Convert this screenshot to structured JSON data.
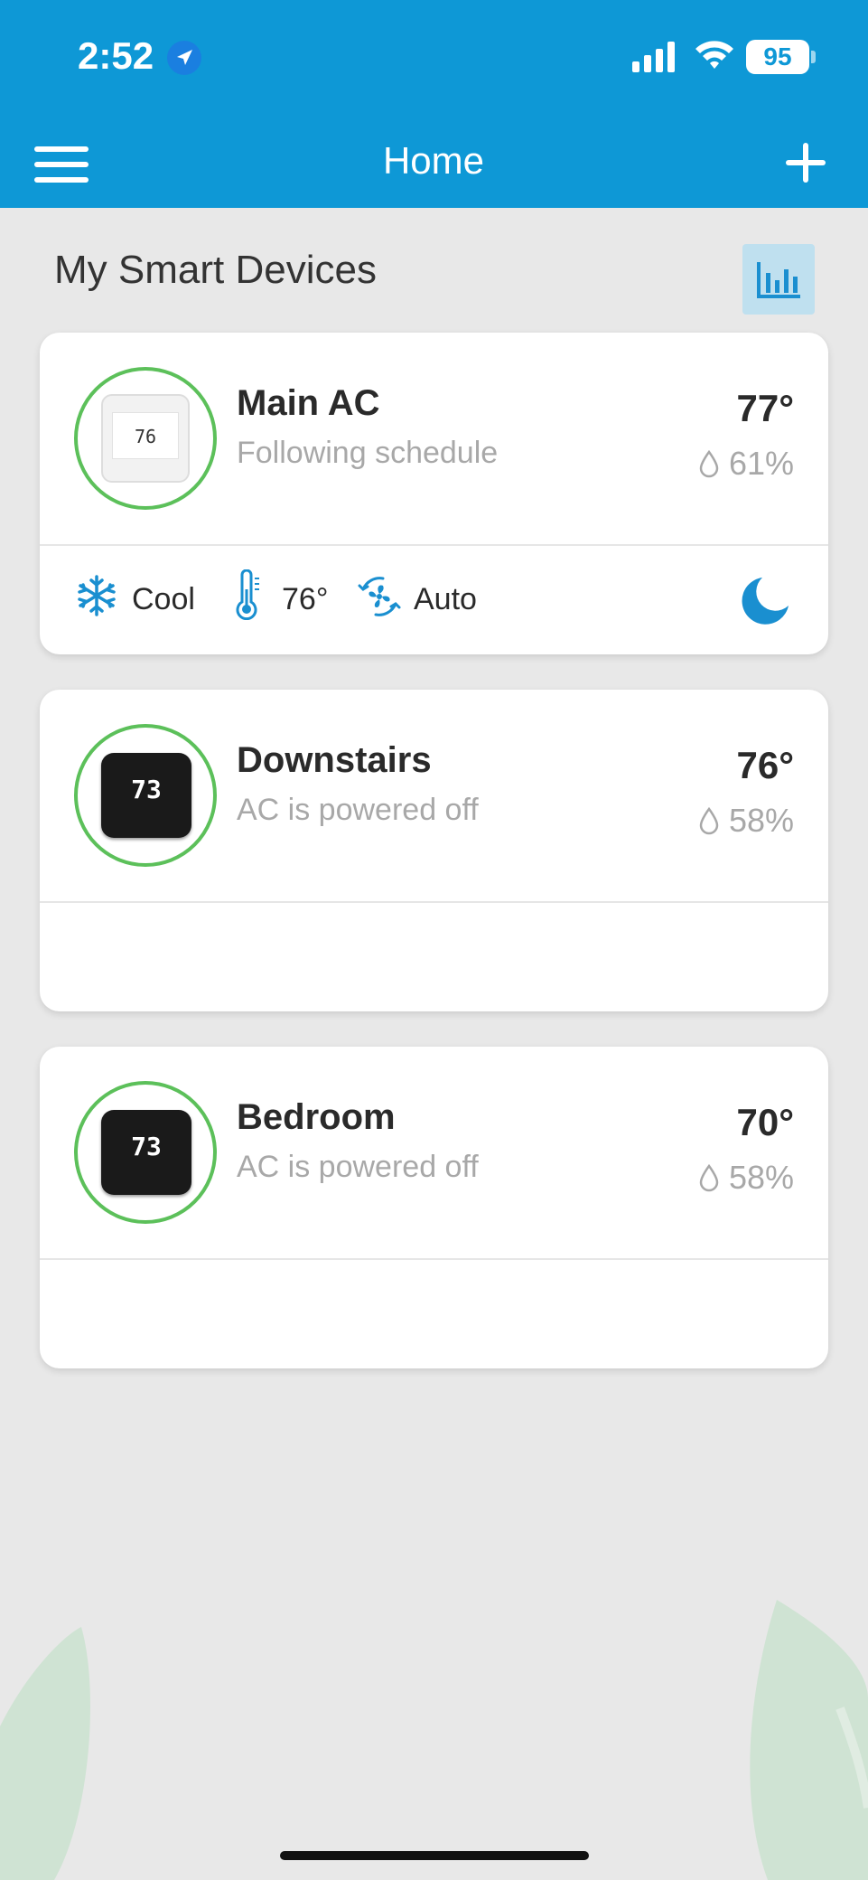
{
  "status_bar": {
    "time": "2:52",
    "battery": "95",
    "location_icon": "location-arrow-icon",
    "signal_icon": "cellular-signal-icon",
    "wifi_icon": "wifi-icon"
  },
  "header": {
    "title": "Home",
    "menu_icon": "hamburger-menu-icon",
    "add_icon": "plus-icon"
  },
  "section": {
    "title": "My Smart Devices",
    "stats_icon": "bar-chart-icon"
  },
  "devices": [
    {
      "name": "Main AC",
      "status": "Following schedule",
      "temperature": "77°",
      "humidity": "61%",
      "device_display": "76",
      "mode": {
        "label": "Cool",
        "icon": "snowflake-icon"
      },
      "target_temp": {
        "label": "76°",
        "icon": "thermometer-icon"
      },
      "fan": {
        "label": "Auto",
        "icon": "fan-icon"
      },
      "sleep_icon": "moon-icon"
    },
    {
      "name": "Downstairs",
      "status": "AC is powered off",
      "temperature": "76°",
      "humidity": "58%",
      "device_display": "73"
    },
    {
      "name": "Bedroom",
      "status": "AC is powered off",
      "temperature": "70°",
      "humidity": "58%",
      "device_display": "73"
    }
  ],
  "colors": {
    "header": "#0e98d6",
    "accent": "#1a8fd0",
    "ring": "#5cc05a",
    "background": "#e8e8e8"
  }
}
